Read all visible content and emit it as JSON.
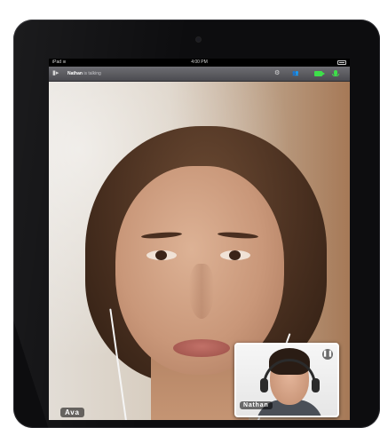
{
  "statusbar": {
    "device": "iPad",
    "wifi_icon": "wifi-icon",
    "time": "4:00 PM",
    "battery_icon": "battery-icon"
  },
  "toolbar": {
    "back_icon": "collapse-panel-icon",
    "caller_name": "Nathan",
    "caller_status": "is talking",
    "icons": [
      "gear-icon",
      "participants-icon",
      "video-camera-icon",
      "microphone-icon"
    ],
    "active_color": "#3ee04a"
  },
  "main_video": {
    "participant_name": "Ava"
  },
  "self_view": {
    "participant_name": "Nathan",
    "pause_icon": "pause-icon",
    "pause_glyph": "❚❚"
  }
}
